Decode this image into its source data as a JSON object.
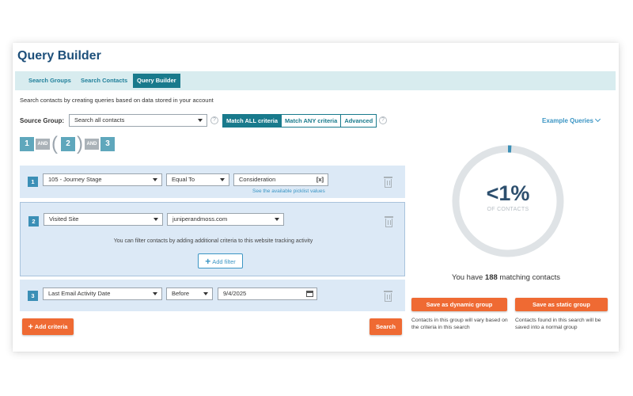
{
  "app": {
    "title": "Query Builder"
  },
  "tabs": [
    {
      "label": "Search Groups",
      "active": false
    },
    {
      "label": "Search Contacts",
      "active": false
    },
    {
      "label": "Query Builder",
      "active": true
    }
  ],
  "description": "Search contacts by creating queries based on data stored in your account",
  "source_group": {
    "label": "Source Group:",
    "value": "Search all contacts"
  },
  "match_buttons": [
    {
      "label": "Match ALL criteria",
      "active": true
    },
    {
      "label": "Match ANY criteria",
      "active": false
    },
    {
      "label": "Advanced",
      "active": false
    }
  ],
  "example_queries": "Example Queries",
  "logic": {
    "n1": "1",
    "and1": "AND",
    "n2": "2",
    "and2": "AND",
    "n3": "3"
  },
  "criteria": [
    {
      "number": "1",
      "field": "105 - Journey Stage",
      "operator": "Equal To",
      "value": "Consideration",
      "value_button": "[x]",
      "picklist_link": "See the available picklist values"
    },
    {
      "number": "2",
      "field": "Visited Site",
      "value": "juniperandmoss.com",
      "note": "You can filter contacts by adding additional criteria to this website tracking activity",
      "add_filter": "Add filter"
    },
    {
      "number": "3",
      "field": "Last Email Activity Date",
      "operator": "Before",
      "value": "9/4/2025"
    }
  ],
  "add_criteria": "Add criteria",
  "search_button": "Search",
  "result": {
    "percent_text": "<1%",
    "percent_value": 0.01,
    "sub_label": "OF CONTACTS",
    "matching_prefix": "You have",
    "matching_count": "188",
    "matching_suffix": "matching contacts"
  },
  "save": {
    "dynamic_label": "Save as dynamic group",
    "dynamic_note": "Contacts in this group will vary based on the criteria in this search",
    "static_label": "Save as static group",
    "static_note": "Contacts found in this search will be saved into a normal group"
  },
  "colors": {
    "primary": "#197a8c",
    "accent_blue": "#3b95c4",
    "orange": "#ef6a33",
    "criteria_bg": "#dce9f6",
    "gauge_track": "#dfe3e6"
  }
}
